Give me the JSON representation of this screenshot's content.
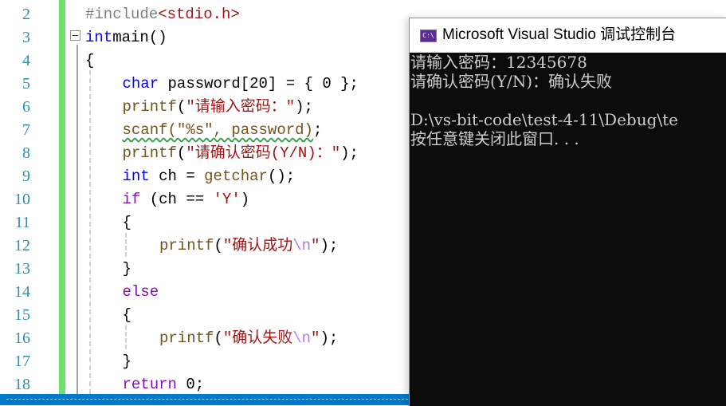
{
  "editor": {
    "lines": [
      {
        "num": "2",
        "parts": [
          [
            "pp",
            "#include"
          ],
          [
            "inc",
            "<stdio.h>"
          ]
        ]
      },
      {
        "num": "3",
        "parts": [
          [
            "kw",
            "int"
          ],
          [
            "",
            "main()"
          ]
        ]
      },
      {
        "num": "4",
        "parts": [
          [
            "",
            "{"
          ]
        ]
      },
      {
        "num": "5",
        "parts": [
          [
            "kw",
            "char"
          ],
          [
            "",
            " password[20] = { 0 };"
          ]
        ]
      },
      {
        "num": "6",
        "parts": [
          [
            "fn",
            "printf"
          ],
          [
            "",
            "("
          ],
          [
            "str",
            "\"请输入密码：\""
          ],
          [
            "",
            ");"
          ]
        ]
      },
      {
        "num": "7",
        "parts": [
          [
            "sq",
            "scanf(\"%s\", password)"
          ],
          [
            "",
            ";"
          ]
        ]
      },
      {
        "num": "8",
        "parts": [
          [
            "fn",
            "printf"
          ],
          [
            "",
            "("
          ],
          [
            "str",
            "\"请确认密码(Y/N)：\""
          ],
          [
            "",
            ");"
          ]
        ]
      },
      {
        "num": "9",
        "parts": [
          [
            "kw",
            "int"
          ],
          [
            "",
            " ch = "
          ],
          [
            "fn",
            "getchar"
          ],
          [
            "",
            "();"
          ]
        ]
      },
      {
        "num": "10",
        "parts": [
          [
            "ctl",
            "if"
          ],
          [
            "",
            " (ch == "
          ],
          [
            "str",
            "'Y'"
          ],
          [
            "",
            ")"
          ]
        ]
      },
      {
        "num": "11",
        "parts": [
          [
            "",
            "{"
          ]
        ]
      },
      {
        "num": "12",
        "parts": [
          [
            "fn",
            "printf"
          ],
          [
            "",
            "("
          ],
          [
            "str",
            "\"确认成功"
          ],
          [
            "esc",
            "\\n"
          ],
          [
            "str",
            "\""
          ],
          [
            "",
            ");"
          ]
        ]
      },
      {
        "num": "13",
        "parts": [
          [
            "",
            "}"
          ]
        ]
      },
      {
        "num": "14",
        "parts": [
          [
            "ctl",
            "else"
          ]
        ]
      },
      {
        "num": "15",
        "parts": [
          [
            "",
            "{"
          ]
        ]
      },
      {
        "num": "16",
        "parts": [
          [
            "fn",
            "printf"
          ],
          [
            "",
            "("
          ],
          [
            "str",
            "\"确认失败"
          ],
          [
            "esc",
            "\\n"
          ],
          [
            "str",
            "\""
          ],
          [
            "",
            ");"
          ]
        ]
      },
      {
        "num": "17",
        "parts": [
          [
            "",
            "}"
          ]
        ]
      },
      {
        "num": "18",
        "parts": [
          [
            "ctl",
            "return"
          ],
          [
            "",
            " 0;"
          ]
        ]
      }
    ]
  },
  "console": {
    "icon": "console-app-icon",
    "title": "Microsoft Visual Studio 调试控制台",
    "output": [
      "请输入密码：12345678",
      "请确认密码(Y/N)：确认失败",
      "",
      "D:\\vs-bit-code\\test-4-11\\Debug\\te",
      "按任意键关闭此窗口. . ."
    ]
  }
}
